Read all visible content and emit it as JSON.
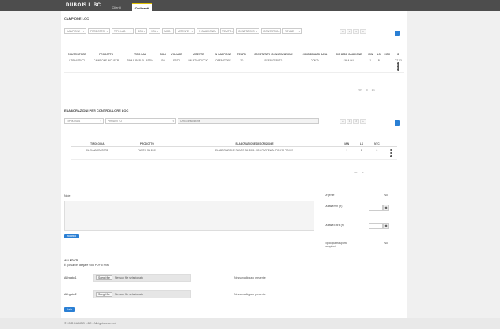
{
  "topbar": {
    "logo": "DUBOIS L.BC",
    "tabs": [
      {
        "label": "Clienti"
      },
      {
        "label": "Ordinanti"
      }
    ]
  },
  "section1": {
    "title": "CAMPIONE LOC",
    "filters": [
      {
        "label": "CAMPIONE"
      },
      {
        "label": "PRODOTTO"
      },
      {
        "label": "TIPO LAB"
      },
      {
        "label": "SOLI"
      },
      {
        "label": "VOL"
      },
      {
        "label": "MOD"
      },
      {
        "label": "MITENTE"
      },
      {
        "label": "N CAMPIONE"
      },
      {
        "label": "TEMPO"
      },
      {
        "label": "CONSTATATO"
      },
      {
        "label": "CONVERSIO"
      },
      {
        "label": "TOTALE"
      }
    ],
    "pager": [
      "«",
      "1",
      "2",
      "»"
    ],
    "columns": [
      "CONTENITORE",
      "PRODOTTO",
      "TIPO LAB",
      "SOLI",
      "VOLUME",
      "MITENTE",
      "N CAMPIONE",
      "TEMPO",
      "CONSTATATO CONSERVAZIONE",
      "CONSEGNATO DATA",
      "RICHIEDE CAMPIONE",
      "MIN",
      "LS",
      "NTC",
      "ID"
    ],
    "rows": [
      [
        "LT PLASTICO",
        "CAMPIONE INDUSTR",
        "DNA E PCR OLI ATTIVI",
        "SO",
        "ESSO",
        "PALATO BOCCIO",
        "OPERATORE",
        "3D",
        "REFRIGERATO",
        "CONTA",
        "SIMA OLI",
        "1",
        "B",
        "",
        "CT-03"
      ]
    ],
    "table_footer": [
      "TOT",
      "0",
      "1/1"
    ]
  },
  "section2": {
    "title": "ELABORAZIONI PER CONTROLLORE LOC",
    "filters": [
      {
        "label": "TIPOLOGIA"
      },
      {
        "label": "PRODOTTO"
      }
    ],
    "search_placeholder": "Cerca descrizione",
    "pager": [
      "«",
      "1",
      "2",
      "»"
    ],
    "columns": [
      "TIPOLOGIA",
      "PRODOTTO",
      "ELABORAZIONE DESCRIZIONE",
      "MIN",
      "LS",
      "NTC"
    ],
    "rows": [
      [
        "CL ELABORATORE",
        "PUNTO SA 2001",
        "ELABORAZIONE PUNTO SA 2001 CON PARTENZA PUNTO PROVE",
        "1",
        "B",
        "0"
      ]
    ],
    "table_footer": [
      "TOT",
      "1"
    ]
  },
  "notes": {
    "label": "Note",
    "button": "Modifica"
  },
  "side": {
    "urgent_label": "Urgente",
    "urgent_value": "No",
    "duration_label": "Durata min (h)",
    "duration_value": "",
    "extra_label": "Durata Extra (h)",
    "extra_value": "",
    "transport_label": "Tipologia trasporto campioni",
    "transport_value": "No"
  },
  "attachments": {
    "title": "ALLEGATI",
    "subtitle": "È possibile allegare solo PDF o PNG",
    "items": [
      {
        "label": "Allegato 1",
        "button": "Scegli file",
        "placeholder": "Nessun file selezionato",
        "status": "Nessun allegato presente"
      },
      {
        "label": "Allegato 2",
        "button": "Scegli file",
        "placeholder": "Nessun file selezionato",
        "status": "Nessun allegato presente"
      }
    ],
    "upload_button": "Invia"
  },
  "footer": {
    "text": "© 2023 DUBOIS L.BC - All rights reserved"
  }
}
